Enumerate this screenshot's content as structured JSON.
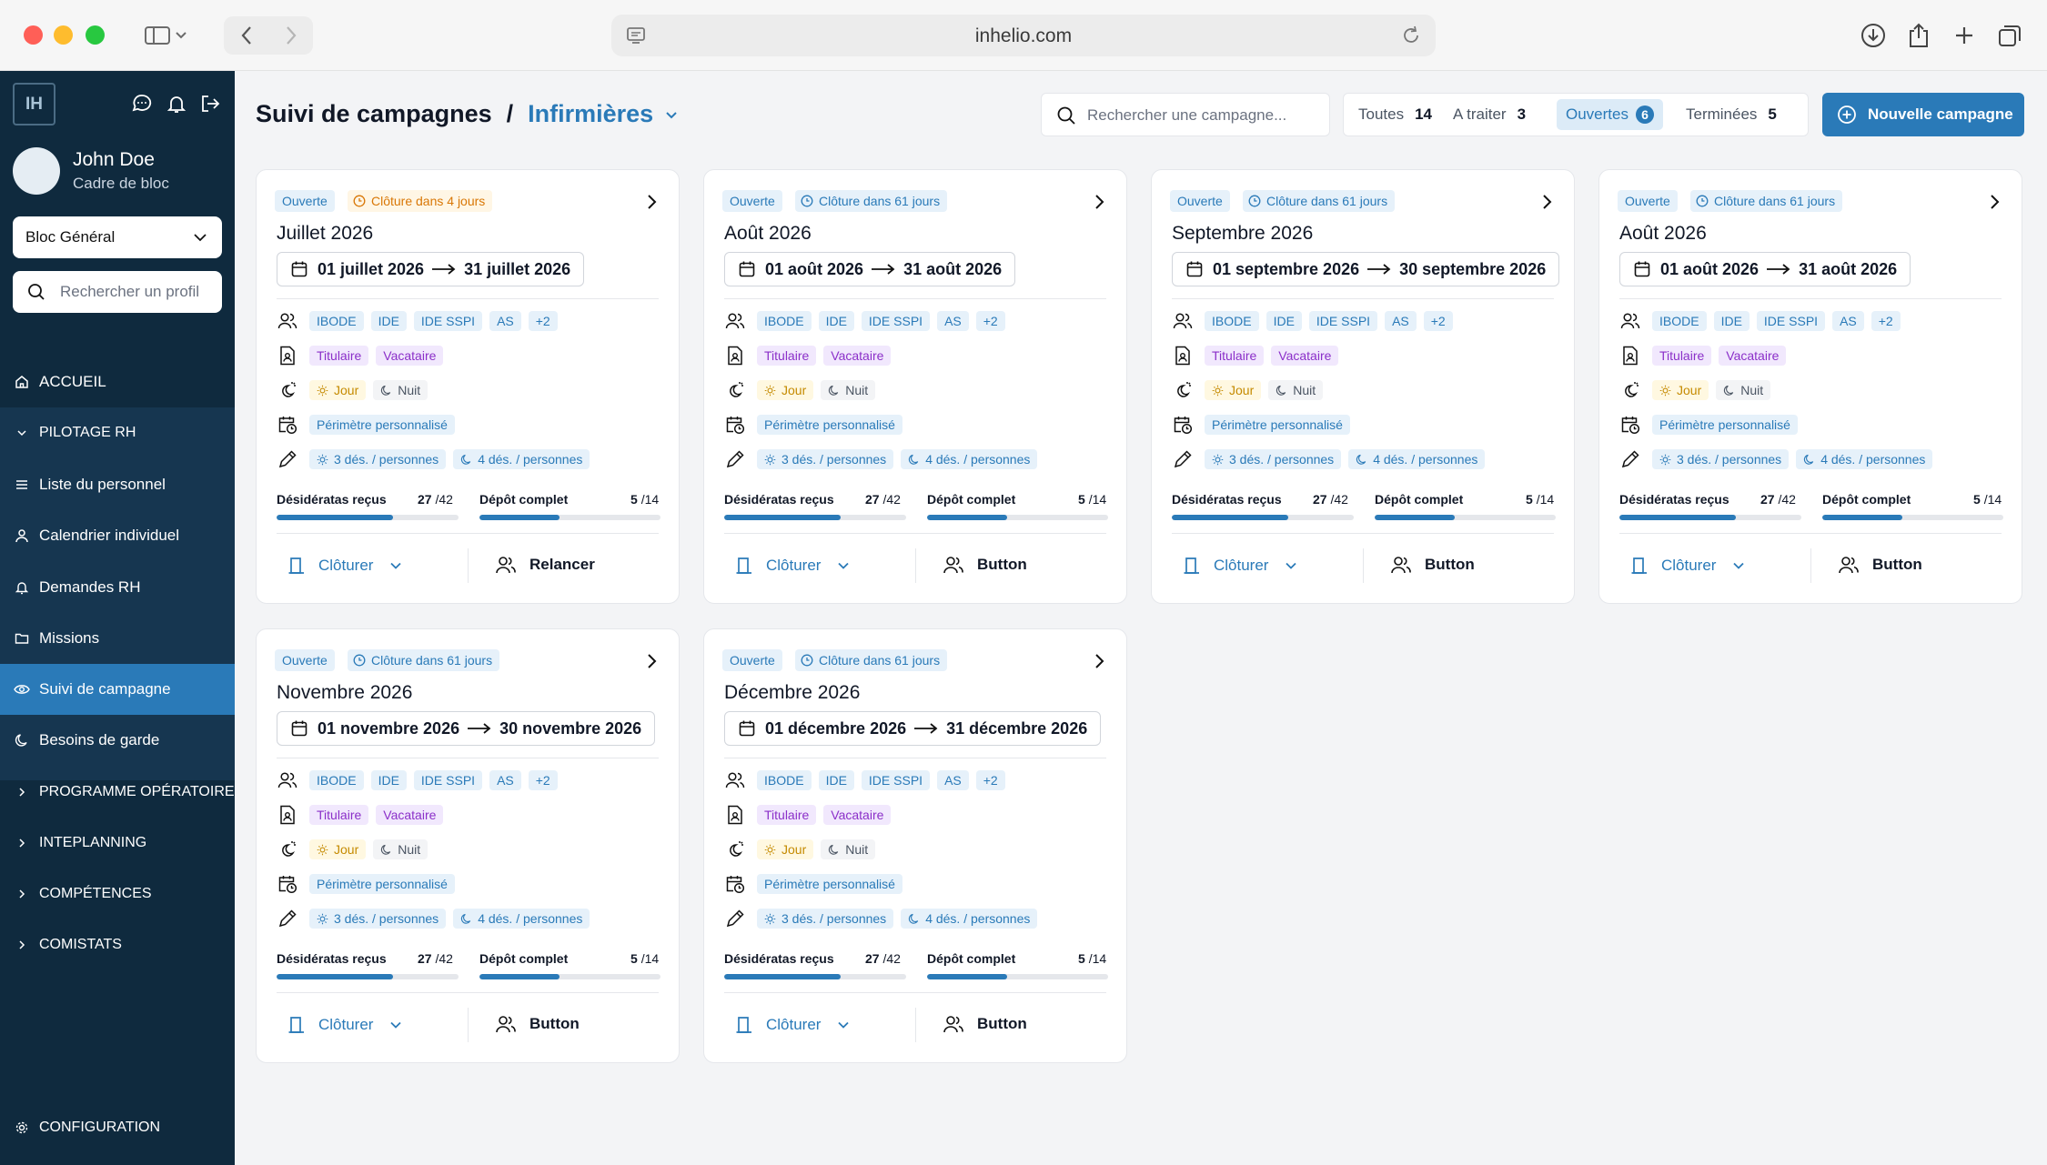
{
  "browser": {
    "url": "inhelio.com"
  },
  "sidebar": {
    "logo": "IH",
    "user": {
      "name": "John Doe",
      "role": "Cadre de bloc"
    },
    "bloc_select": "Bloc Général",
    "search_placeholder": "Rechercher un profil",
    "menu": {
      "accueil": "ACCUEIL",
      "pilotage": "PILOTAGE RH",
      "liste": "Liste du personnel",
      "calendrier": "Calendrier individuel",
      "demandes": "Demandes RH",
      "missions": "Missions",
      "suivi": "Suivi de campagne",
      "besoins": "Besoins de garde",
      "programme": "PROGRAMME OPÉRATOIRE",
      "inteplanning": "INTEPLANNING",
      "competences": "COMPÉTENCES",
      "comistats": "COMISTATS",
      "configuration": "CONFIGURATION"
    }
  },
  "header": {
    "breadcrumb_root": "Suivi de campagnes",
    "breadcrumb_sep": "/",
    "breadcrumb_current": "Infirmières",
    "search_placeholder": "Rechercher une campagne...",
    "filters": [
      {
        "label": "Toutes",
        "count": "14"
      },
      {
        "label": "A traiter",
        "count": "3"
      },
      {
        "label": "Ouvertes",
        "count": "6"
      },
      {
        "label": "Terminées",
        "count": "5"
      }
    ],
    "new_button": "Nouvelle campagne"
  },
  "colors": {
    "accent": "#2a7ab8",
    "sidebar": "#0f2a3e",
    "warning": "#d97706",
    "purple": "#8b2fc9"
  },
  "cards": [
    {
      "status": "Ouverte",
      "closing": "Clôture dans 4 jours",
      "closing_warn": true,
      "title": "Juillet 2026",
      "date_start": "01 juillet 2026",
      "date_end": "31 juillet 2026",
      "roles": [
        "IBODE",
        "IDE",
        "IDE SSPI",
        "AS",
        "+2"
      ],
      "contracts": [
        "Titulaire",
        "Vacataire"
      ],
      "shifts": [
        "Jour",
        "Nuit"
      ],
      "perimeter": "Périmètre personnalisé",
      "desiderata": [
        "3 dés. / personnes",
        "4 dés. / personnes"
      ],
      "stat1_label": "Désidératas reçus",
      "stat1_value": "27",
      "stat1_total": "/42",
      "stat1_progress": 0.64,
      "stat2_label": "Dépôt complet",
      "stat2_value": "5",
      "stat2_total": "/14",
      "stat2_progress": 0.44,
      "close_action": "Clôturer",
      "second_action": "Relancer"
    },
    {
      "status": "Ouverte",
      "closing": "Clôture dans 61 jours",
      "closing_warn": false,
      "title": "Août 2026",
      "date_start": "01 août 2026",
      "date_end": "31 août 2026",
      "roles": [
        "IBODE",
        "IDE",
        "IDE SSPI",
        "AS",
        "+2"
      ],
      "contracts": [
        "Titulaire",
        "Vacataire"
      ],
      "shifts": [
        "Jour",
        "Nuit"
      ],
      "perimeter": "Périmètre personnalisé",
      "desiderata": [
        "3 dés. / personnes",
        "4 dés. / personnes"
      ],
      "stat1_label": "Désidératas reçus",
      "stat1_value": "27",
      "stat1_total": "/42",
      "stat1_progress": 0.64,
      "stat2_label": "Dépôt complet",
      "stat2_value": "5",
      "stat2_total": "/14",
      "stat2_progress": 0.44,
      "close_action": "Clôturer",
      "second_action": "Button"
    },
    {
      "status": "Ouverte",
      "closing": "Clôture dans 61 jours",
      "closing_warn": false,
      "title": "Septembre 2026",
      "date_start": "01 septembre 2026",
      "date_end": "30 septembre 2026",
      "roles": [
        "IBODE",
        "IDE",
        "IDE SSPI",
        "AS",
        "+2"
      ],
      "contracts": [
        "Titulaire",
        "Vacataire"
      ],
      "shifts": [
        "Jour",
        "Nuit"
      ],
      "perimeter": "Périmètre personnalisé",
      "desiderata": [
        "3 dés. / personnes",
        "4 dés. / personnes"
      ],
      "stat1_label": "Désidératas reçus",
      "stat1_value": "27",
      "stat1_total": "/42",
      "stat1_progress": 0.64,
      "stat2_label": "Dépôt complet",
      "stat2_value": "5",
      "stat2_total": "/14",
      "stat2_progress": 0.44,
      "close_action": "Clôturer",
      "second_action": "Button"
    },
    {
      "status": "Ouverte",
      "closing": "Clôture dans 61 jours",
      "closing_warn": false,
      "title": "Août 2026",
      "date_start": "01 août 2026",
      "date_end": "31 août 2026",
      "roles": [
        "IBODE",
        "IDE",
        "IDE SSPI",
        "AS",
        "+2"
      ],
      "contracts": [
        "Titulaire",
        "Vacataire"
      ],
      "shifts": [
        "Jour",
        "Nuit"
      ],
      "perimeter": "Périmètre personnalisé",
      "desiderata": [
        "3 dés. / personnes",
        "4 dés. / personnes"
      ],
      "stat1_label": "Désidératas reçus",
      "stat1_value": "27",
      "stat1_total": "/42",
      "stat1_progress": 0.64,
      "stat2_label": "Dépôt complet",
      "stat2_value": "5",
      "stat2_total": "/14",
      "stat2_progress": 0.44,
      "close_action": "Clôturer",
      "second_action": "Button"
    },
    {
      "status": "Ouverte",
      "closing": "Clôture dans 61 jours",
      "closing_warn": false,
      "title": "Novembre 2026",
      "date_start": "01 novembre 2026",
      "date_end": "30 novembre 2026",
      "roles": [
        "IBODE",
        "IDE",
        "IDE SSPI",
        "AS",
        "+2"
      ],
      "contracts": [
        "Titulaire",
        "Vacataire"
      ],
      "shifts": [
        "Jour",
        "Nuit"
      ],
      "perimeter": "Périmètre personnalisé",
      "desiderata": [
        "3 dés. / personnes",
        "4 dés. / personnes"
      ],
      "stat1_label": "Désidératas reçus",
      "stat1_value": "27",
      "stat1_total": "/42",
      "stat1_progress": 0.64,
      "stat2_label": "Dépôt complet",
      "stat2_value": "5",
      "stat2_total": "/14",
      "stat2_progress": 0.44,
      "close_action": "Clôturer",
      "second_action": "Button"
    },
    {
      "status": "Ouverte",
      "closing": "Clôture dans 61 jours",
      "closing_warn": false,
      "title": "Décembre 2026",
      "date_start": "01 décembre 2026",
      "date_end": "31 décembre 2026",
      "roles": [
        "IBODE",
        "IDE",
        "IDE SSPI",
        "AS",
        "+2"
      ],
      "contracts": [
        "Titulaire",
        "Vacataire"
      ],
      "shifts": [
        "Jour",
        "Nuit"
      ],
      "perimeter": "Périmètre personnalisé",
      "desiderata": [
        "3 dés. / personnes",
        "4 dés. / personnes"
      ],
      "stat1_label": "Désidératas reçus",
      "stat1_value": "27",
      "stat1_total": "/42",
      "stat1_progress": 0.64,
      "stat2_label": "Dépôt complet",
      "stat2_value": "5",
      "stat2_total": "/14",
      "stat2_progress": 0.44,
      "close_action": "Clôturer",
      "second_action": "Button"
    }
  ]
}
